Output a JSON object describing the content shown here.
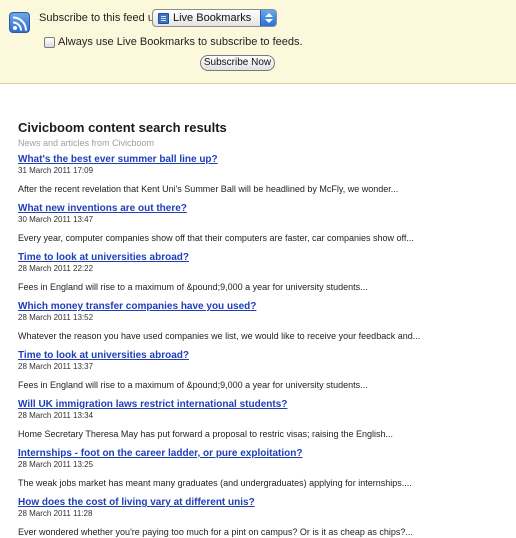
{
  "subscribe_bar": {
    "icon": "rss-feed-icon",
    "label": "Subscribe to this feed using",
    "reader_select": {
      "selected": "Live Bookmarks",
      "icon": "bookmarks-book-icon"
    },
    "always_use_label": "Always use Live Bookmarks to subscribe to feeds.",
    "always_use_checked": false,
    "subscribe_button_label": "Subscribe Now"
  },
  "feed": {
    "title": "Civicboom content search results",
    "subtitle": "News and articles from Civicboom",
    "entries": [
      {
        "title": "What's the best ever summer ball line up?",
        "date": "31 March 2011 17:09",
        "summary": "After the recent revelation that Kent Uni's Summer Ball will be headlined by McFly, we wonder..."
      },
      {
        "title": "What new inventions are out there?",
        "date": "30 March 2011 13:47",
        "summary": "Every year, computer companies show off that their computers are faster, car companies show off..."
      },
      {
        "title": "Time to look at universities abroad?",
        "date": "28 March 2011 22:22",
        "summary": "Fees in England will rise to a maximum of &pound;9,000 a year for university students..."
      },
      {
        "title": "Which money transfer companies have you used?",
        "date": "28 March 2011 13:52",
        "summary": "Whatever the reason you have used companies we list, we would like to receive your feedback and..."
      },
      {
        "title": "Time to look at universities abroad?",
        "date": "28 March 2011 13:37",
        "summary": "Fees in England will rise to a maximum of &pound;9,000 a year for university students..."
      },
      {
        "title": "Will UK immigration laws restrict international students?",
        "date": "28 March 2011 13:34",
        "summary": "Home Secretary Theresa May has put forward a proposal to restric visas; raising the English..."
      },
      {
        "title": "Internships - foot on the career ladder, or pure exploitation?",
        "date": "28 March 2011 13:25",
        "summary": "The weak jobs market has meant many graduates (and undergraduates) applying for internships...."
      },
      {
        "title": "How does the cost of living vary at different unis?",
        "date": "28 March 2011 11:28",
        "summary": "Ever wondered whether you're paying too much for a pint on campus? Or is it as cheap as chips?..."
      }
    ]
  },
  "colors": {
    "subscribe_bar_bg": "#fbf8dc",
    "link": "#1f3fb8",
    "subtitle": "#a0a0a0"
  }
}
